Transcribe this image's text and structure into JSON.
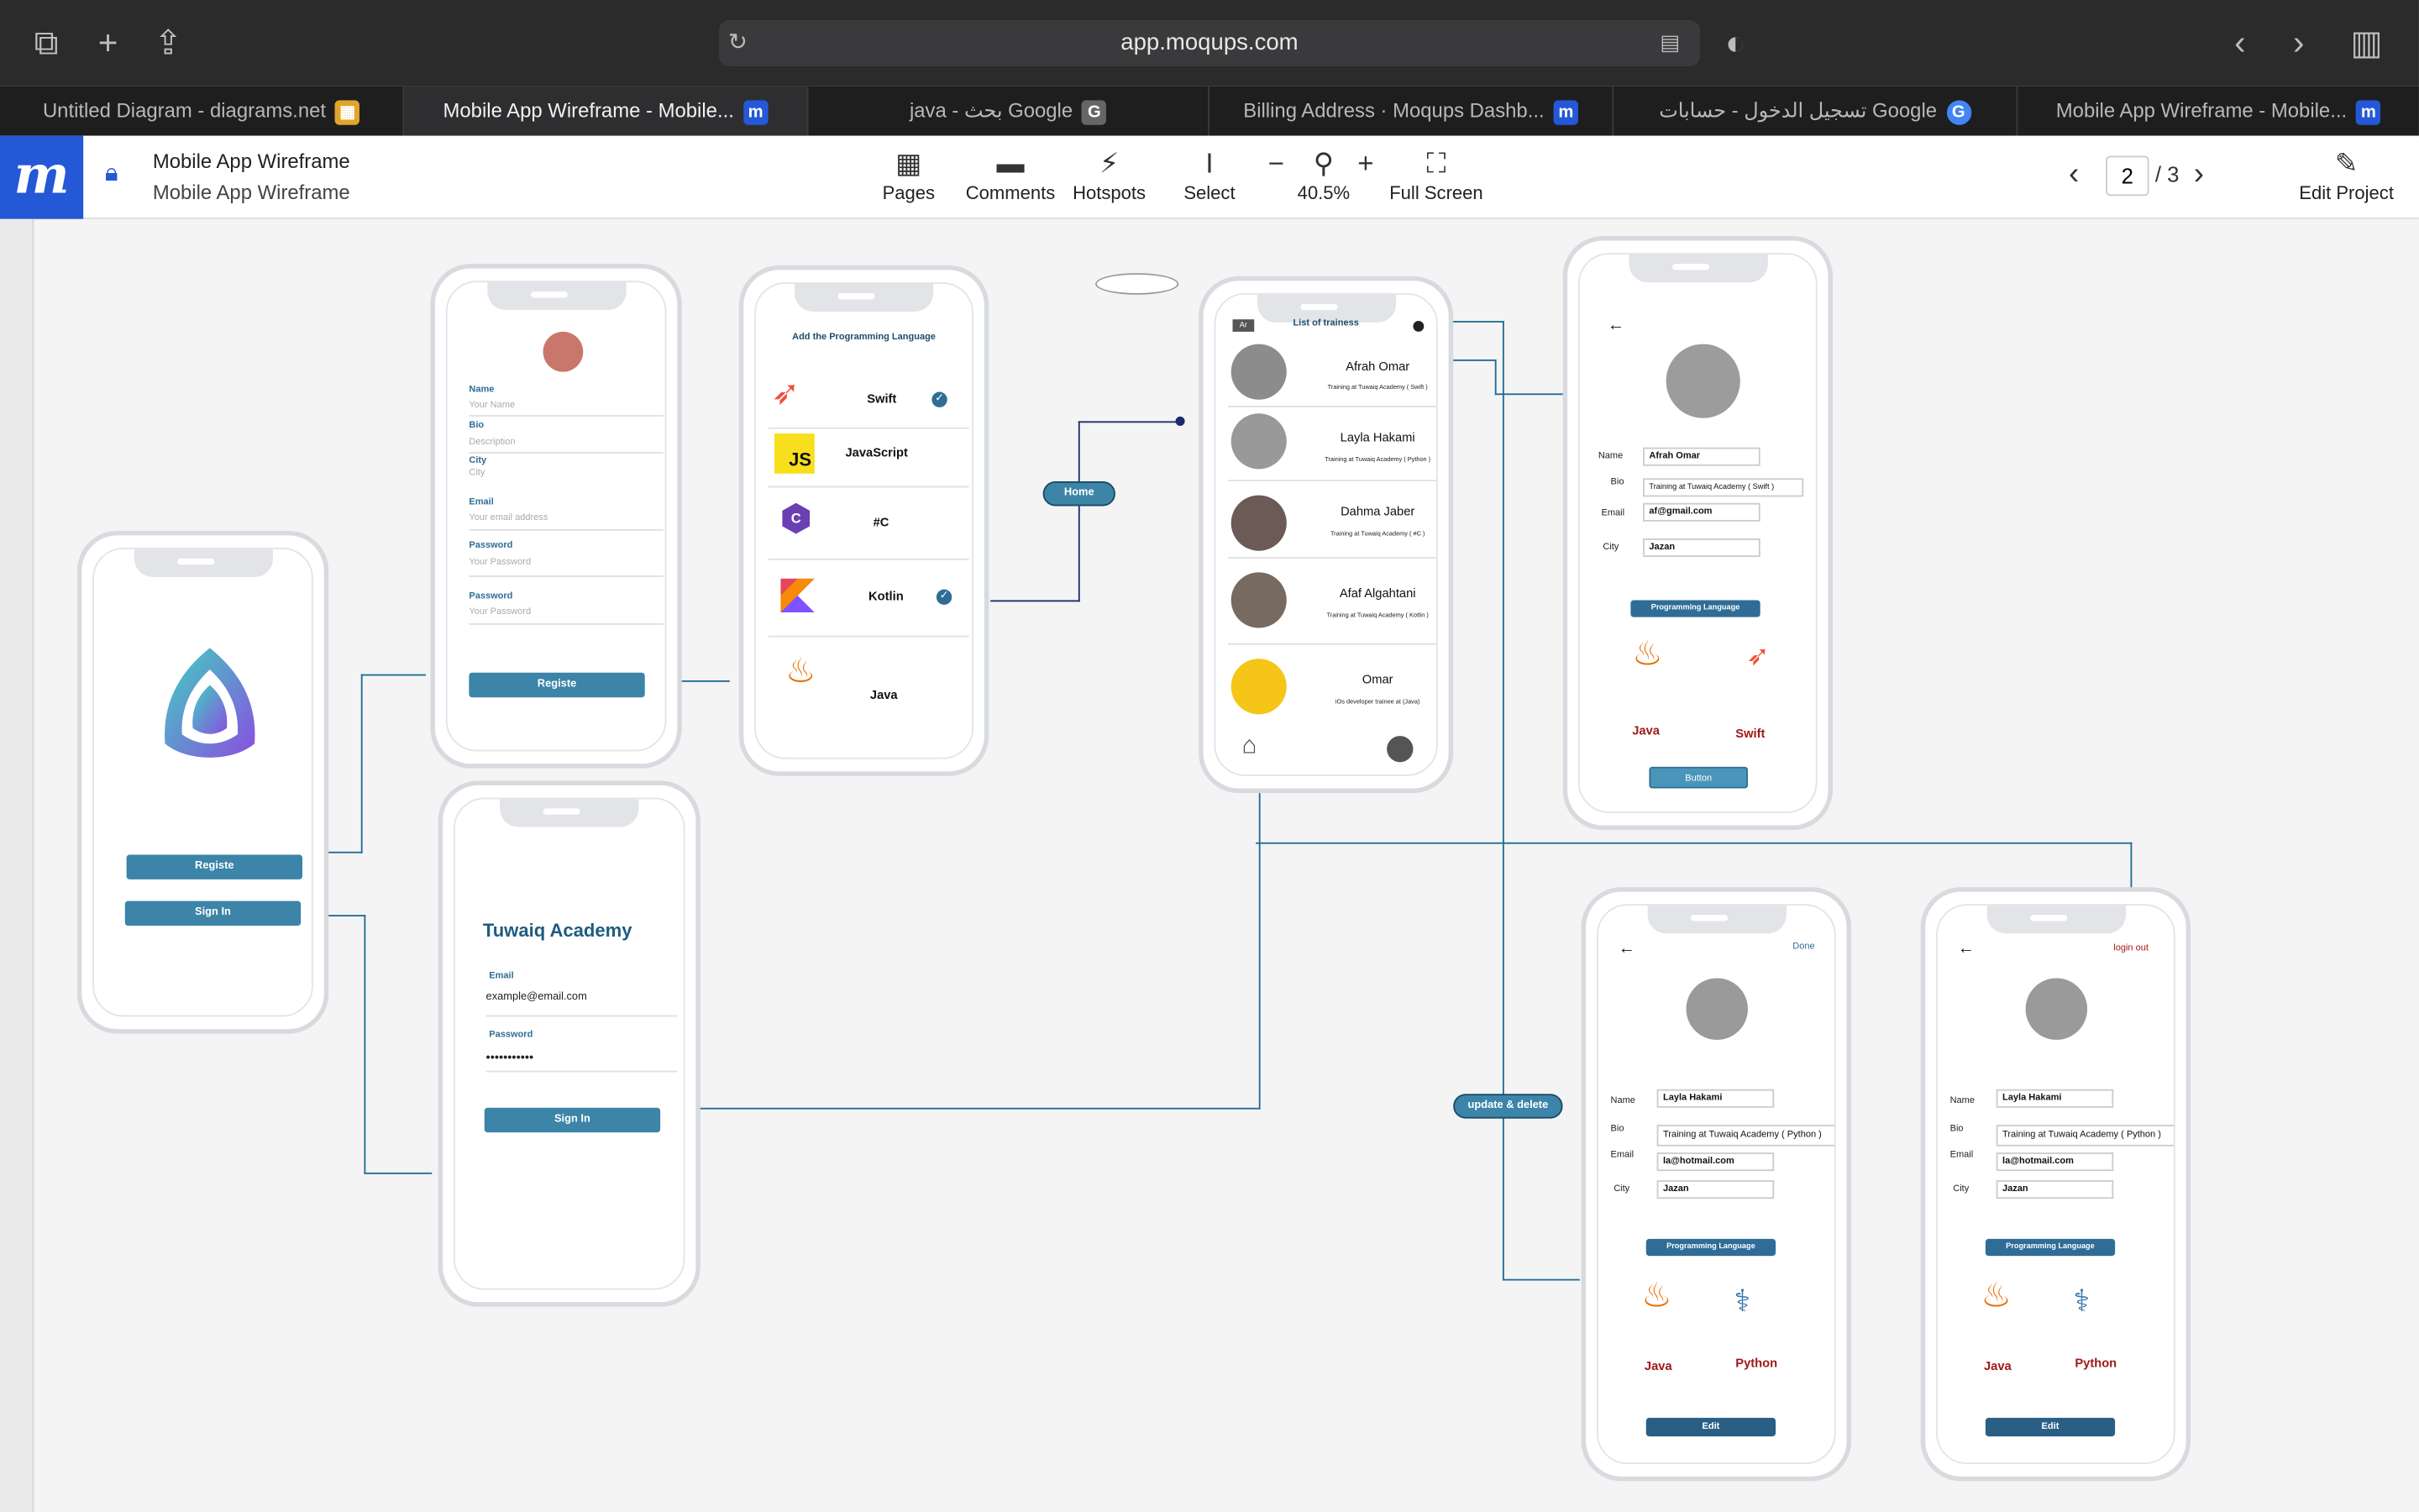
{
  "browser": {
    "url": "app.moqups.com",
    "tabs": [
      {
        "label": "Untitled Diagram - diagrams.net",
        "fav": "▦",
        "fav_color": "#e0a52b"
      },
      {
        "label": "Mobile App Wireframe - Mobile...",
        "fav": "m",
        "fav_color": "#2458d6"
      },
      {
        "label": "java - بحث Google",
        "fav": "G",
        "fav_color": "#666666"
      },
      {
        "label": "Billing Address · Moqups Dashb...",
        "fav": "m",
        "fav_color": "#2458d6"
      },
      {
        "label": "تسجيل الدخول - حسابات Google",
        "fav": "G",
        "fav_color": "#4285f4"
      },
      {
        "label": "Mobile App Wireframe - Mobile...",
        "fav": "m",
        "fav_color": "#2458d6"
      }
    ]
  },
  "app": {
    "logo": "m",
    "project_title": "Mobile App Wireframe",
    "project_subtitle": "Mobile App Wireframe",
    "tools": {
      "pages": "Pages",
      "comments": "Comments",
      "hotspots": "Hotspots",
      "select": "Select",
      "zoom": "40.5%",
      "fullscreen": "Full Screen",
      "edit": "Edit Project"
    },
    "page_current": "2",
    "page_total": "/ 3"
  },
  "splash": {
    "register": "Registe",
    "sign_in": "Sign In"
  },
  "register": {
    "name_label": "Name",
    "name_ph": "Your Name",
    "bio_label": "Bio",
    "bio_ph": "Description",
    "city_label": "City",
    "city_ph": "City",
    "email_label": "Email",
    "email_ph": "Your email address",
    "password_label": "Password",
    "password_ph": "Your Password",
    "password2_label": "Password",
    "password2_ph": "Your Password",
    "button": "Registe"
  },
  "signin": {
    "title": "Tuwaiq Academy",
    "email_label": "Email",
    "email_value": "example@email.com",
    "password_label": "Password",
    "password_value": "•••••••••••",
    "button": "Sign In"
  },
  "languages": {
    "title": "Add the Programming Language",
    "items": [
      {
        "name": "Swift",
        "checked": true
      },
      {
        "name": "JavaScript",
        "checked": false
      },
      {
        "name": "#C",
        "checked": false
      },
      {
        "name": "Kotlin",
        "checked": true
      },
      {
        "name": "Java",
        "checked": false
      }
    ]
  },
  "trainees": {
    "lang_toggle": "Ar",
    "title": "List of trainess",
    "items": [
      {
        "name": "Afrah Omar",
        "desc": "Training at Tuwaiq Academy ( Swift )"
      },
      {
        "name": "Layla Hakami",
        "desc": "Training at Tuwaiq Academy ( Python )"
      },
      {
        "name": "Dahma Jaber",
        "desc": "Training at Tuwaiq Academy ( #C )"
      },
      {
        "name": "Afaf Algahtani",
        "desc": "Training at Tuwaiq Academy ( Kotlin )"
      },
      {
        "name": "Omar",
        "desc": "iOs developer trainee at (Java)"
      }
    ]
  },
  "profile_afrah": {
    "back": "←",
    "name_label": "Name",
    "name": "Afrah Omar",
    "bio_label": "Bio",
    "bio": "Training at Tuwaiq Academy ( Swift )",
    "email_label": "Email",
    "email": "af@gmail.com",
    "city_label": "City",
    "city": "Jazan",
    "lang_button": "Programming Language",
    "lang1": "Java",
    "lang2": "Swift",
    "button": "Button"
  },
  "profile_layla_edit": {
    "back": "←",
    "done": "Done",
    "name_label": "Name",
    "name": "Layla Hakami",
    "bio_label": "Bio",
    "bio": "Training at Tuwaiq Academy ( Python )",
    "email_label": "Email",
    "email": "la@hotmail.com",
    "city_label": "City",
    "city": "Jazan",
    "lang_button": "Programming Language",
    "lang1": "Java",
    "lang2": "Python",
    "button": "Edit"
  },
  "profile_layla_logout": {
    "back": "←",
    "logout": "login out",
    "name_label": "Name",
    "name": "Layla Hakami",
    "bio_label": "Bio",
    "bio": "Training at Tuwaiq Academy ( Python )",
    "email_label": "Email",
    "email": "la@hotmail.com",
    "city_label": "City",
    "city": "Jazan",
    "lang_button": "Programming Language",
    "lang1": "Java",
    "lang2": "Python",
    "button": "Edit"
  },
  "connectors": {
    "home": "Home",
    "update_delete": "update & delete"
  },
  "colors": {
    "accent": "#3c84a8",
    "brand": "#2458d6",
    "connector": "#1f6c94",
    "lang_red": "#a01818"
  }
}
